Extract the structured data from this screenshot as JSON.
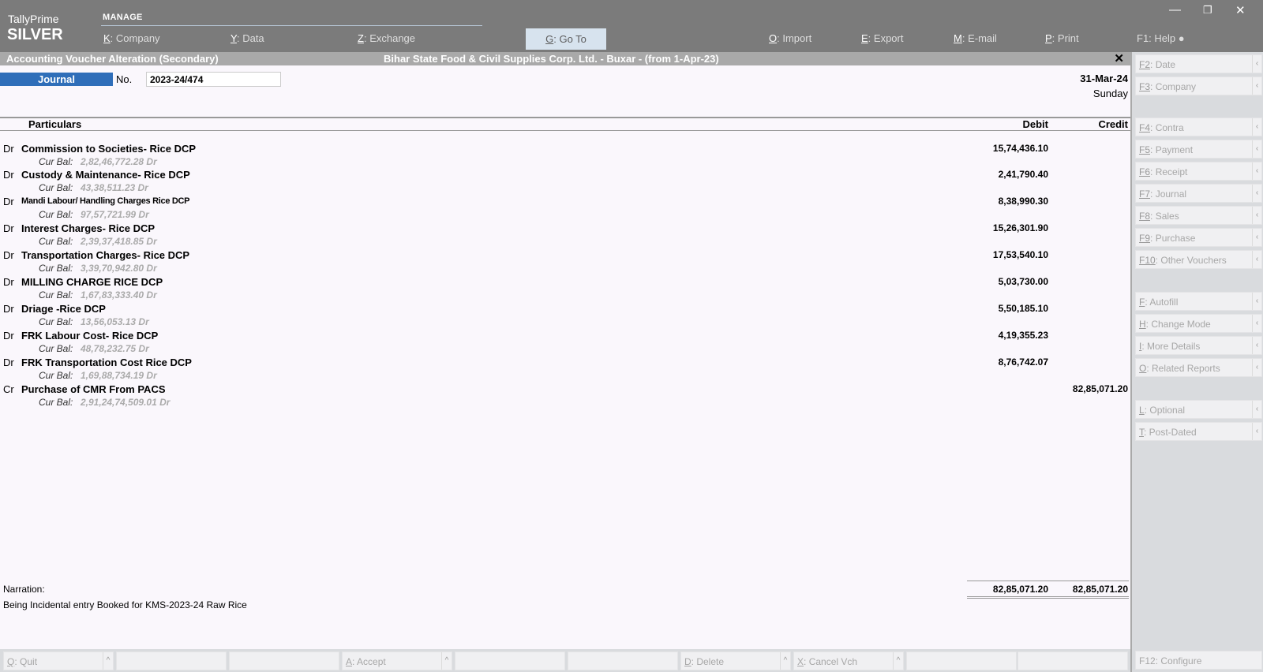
{
  "brand": {
    "name": "TallyPrime",
    "edition": "SILVER"
  },
  "top_menu": {
    "section": "MANAGE",
    "items": [
      {
        "key": "K",
        "label": "Company"
      },
      {
        "key": "Y",
        "label": "Data"
      },
      {
        "key": "Z",
        "label": "Exchange"
      },
      {
        "key": "G",
        "label": "Go To"
      },
      {
        "key": "O",
        "label": "Import"
      },
      {
        "key": "E",
        "label": "Export"
      },
      {
        "key": "M",
        "label": "E-mail"
      },
      {
        "key": "P",
        "label": "Print"
      },
      {
        "key": "F1",
        "label": "Help ●"
      }
    ]
  },
  "window_controls": {
    "minimize": "—",
    "restore": "❐",
    "close": "✕"
  },
  "titlebar": {
    "title": "Accounting Voucher Alteration (Secondary)",
    "company": "Bihar State Food & Civil Supplies Corp. Ltd. - Buxar - (from 1-Apr-23)",
    "close": "✕"
  },
  "voucher": {
    "type": "Journal",
    "no_label": "No.",
    "number": "2023-24/474",
    "date": "31-Mar-24",
    "day": "Sunday"
  },
  "columns": {
    "particulars": "Particulars",
    "debit": "Debit",
    "credit": "Credit"
  },
  "cur_bal_label": "Cur Bal:",
  "entries": [
    {
      "drcr": "Dr",
      "ledger": "Commission to Societies- Rice DCP",
      "debit": "15,74,436.10",
      "credit": "",
      "balance": "2,82,46,772.28 Dr"
    },
    {
      "drcr": "Dr",
      "ledger": "Custody & Maintenance- Rice DCP",
      "debit": "2,41,790.40",
      "credit": "",
      "balance": "43,38,511.23 Dr"
    },
    {
      "drcr": "Dr",
      "ledger": "Mandi Labour/ Handling Charges Rice DCP",
      "debit": "8,38,990.30",
      "credit": "",
      "balance": "97,57,721.99 Dr"
    },
    {
      "drcr": "Dr",
      "ledger": "Interest Charges- Rice DCP",
      "debit": "15,26,301.90",
      "credit": "",
      "balance": "2,39,37,418.85 Dr"
    },
    {
      "drcr": "Dr",
      "ledger": "Transportation Charges- Rice DCP",
      "debit": "17,53,540.10",
      "credit": "",
      "balance": "3,39,70,942.80 Dr"
    },
    {
      "drcr": "Dr",
      "ledger": "MILLING CHARGE RICE DCP",
      "debit": "5,03,730.00",
      "credit": "",
      "balance": "1,67,83,333.40 Dr"
    },
    {
      "drcr": "Dr",
      "ledger": "Driage -Rice DCP",
      "debit": "5,50,185.10",
      "credit": "",
      "balance": "13,56,053.13 Dr"
    },
    {
      "drcr": "Dr",
      "ledger": "FRK Labour Cost- Rice DCP",
      "debit": "4,19,355.23",
      "credit": "",
      "balance": "48,78,232.75 Dr"
    },
    {
      "drcr": "Dr",
      "ledger": "FRK Transportation Cost Rice DCP",
      "debit": "8,76,742.07",
      "credit": "",
      "balance": "1,69,88,734.19 Dr"
    },
    {
      "drcr": "Cr",
      "ledger": "Purchase of CMR From PACS",
      "debit": "",
      "credit": "82,85,071.20",
      "balance": "2,91,24,74,509.01 Dr"
    }
  ],
  "narration": {
    "label": "Narration:",
    "text": "Being Incidental entry Booked for KMS-2023-24 Raw Rice"
  },
  "totals": {
    "debit": "82,85,071.20",
    "credit": "82,85,071.20"
  },
  "right_panel": [
    {
      "key": "F2",
      "label": "Date"
    },
    {
      "key": "F3",
      "label": "Company"
    },
    {
      "key": "F4",
      "label": "Contra"
    },
    {
      "key": "F5",
      "label": "Payment"
    },
    {
      "key": "F6",
      "label": "Receipt"
    },
    {
      "key": "F7",
      "label": "Journal"
    },
    {
      "key": "F8",
      "label": "Sales"
    },
    {
      "key": "F9",
      "label": "Purchase"
    },
    {
      "key": "F10",
      "label": "Other Vouchers"
    },
    {
      "key": "F",
      "label": "Autofill"
    },
    {
      "key": "H",
      "label": "Change Mode"
    },
    {
      "key": "I",
      "label": "More Details"
    },
    {
      "key": "O",
      "label": "Related Reports"
    },
    {
      "key": "L",
      "label": "Optional"
    },
    {
      "key": "T",
      "label": "Post-Dated"
    },
    {
      "key": "F12",
      "label": "Configure"
    }
  ],
  "bottom_bar": [
    {
      "key": "Q",
      "label": "Quit"
    },
    {
      "key": "",
      "label": ""
    },
    {
      "key": "",
      "label": ""
    },
    {
      "key": "A",
      "label": "Accept"
    },
    {
      "key": "",
      "label": ""
    },
    {
      "key": "",
      "label": ""
    },
    {
      "key": "D",
      "label": "Delete"
    },
    {
      "key": "X",
      "label": "Cancel Vch"
    },
    {
      "key": "",
      "label": ""
    },
    {
      "key": "",
      "label": ""
    }
  ],
  "chevron": "‹",
  "up_chevron": "^"
}
